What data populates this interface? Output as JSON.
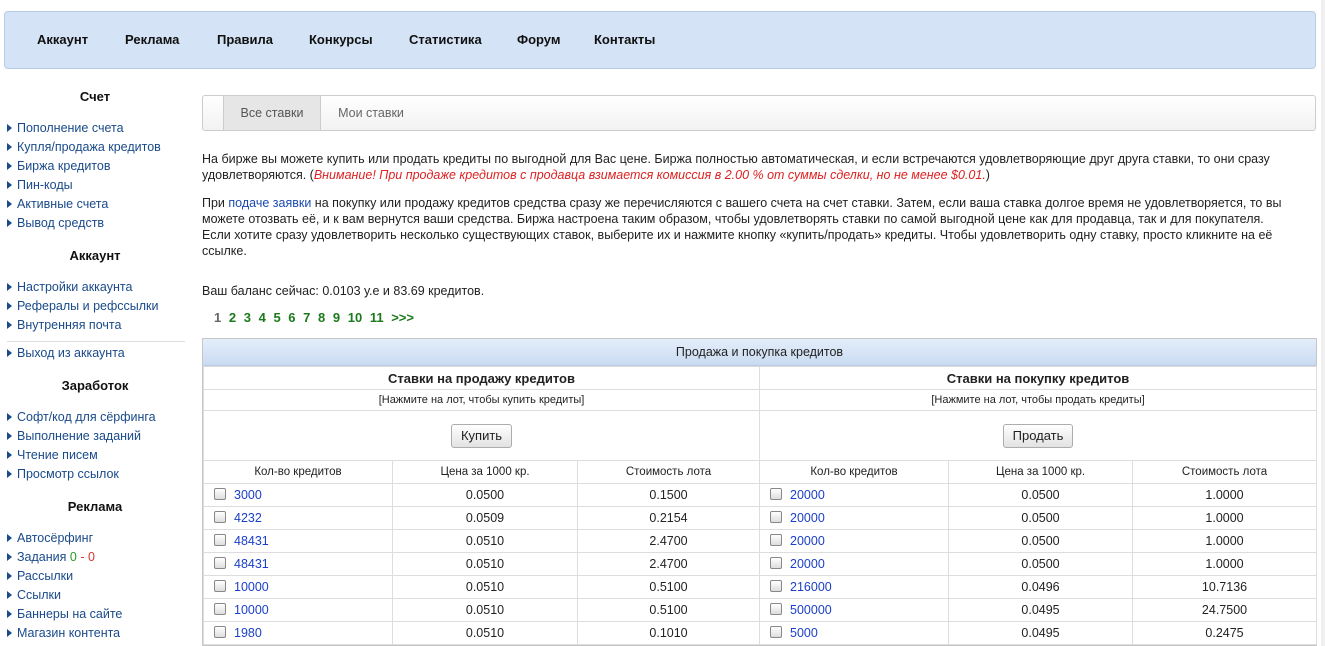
{
  "nav": [
    "Аккаунт",
    "Реклама",
    "Правила",
    "Конкурсы",
    "Статистика",
    "Форум",
    "Контакты"
  ],
  "sidebar": {
    "sections": [
      {
        "title": "Счет",
        "items": [
          {
            "label": "Пополнение счета"
          },
          {
            "label": "Купля/продажа кредитов"
          },
          {
            "label": "Биржа кредитов"
          },
          {
            "label": "Пин-коды"
          },
          {
            "label": "Активные счета"
          },
          {
            "label": "Вывод средств"
          }
        ]
      },
      {
        "title": "Аккаунт",
        "items": [
          {
            "label": "Настройки аккаунта"
          },
          {
            "label": "Рефералы и рефссылки"
          },
          {
            "label": "Внутренняя почта"
          }
        ]
      },
      {
        "title": "",
        "items": [
          {
            "label": "Выход из аккаунта"
          }
        ]
      },
      {
        "title": "Заработок",
        "items": [
          {
            "label": "Софт/код для сёрфинга"
          },
          {
            "label": "Выполнение заданий"
          },
          {
            "label": "Чтение писем"
          },
          {
            "label": "Просмотр ссылок"
          }
        ]
      },
      {
        "title": "Реклама",
        "items": [
          {
            "label": "Автосёрфинг"
          },
          {
            "label": "Задания",
            "badge_a": "0",
            "badge_sep": " - ",
            "badge_b": "0"
          },
          {
            "label": "Рассылки"
          },
          {
            "label": "Ссылки"
          },
          {
            "label": "Баннеры на сайте"
          },
          {
            "label": "Магазин контента"
          }
        ]
      }
    ]
  },
  "tabs": {
    "all": "Все ставки",
    "mine": "Мои ставки"
  },
  "intro": {
    "p1": "На бирже вы можете купить или продать кредиты по выгодной для Вас цене. Биржа полностью автоматическая, и если встречаются удовлетворяющие друг друга ставки, то они сразу удовлетворяются. (",
    "p1_warn": "Внимание! При продаже кредитов с продавца взимается комиссия в 2.00 % от суммы сделки, но не менее $0.01.",
    "p1_end": ")",
    "p2_pre": "При ",
    "p2_link": "подаче заявки",
    "p2_post": " на покупку или продажу кредитов средства сразу же перечисляются с вашего счета на счет ставки. Затем, если ваша ставка долгое время не удовлетворяется, то вы можете отозвать её, и к вам вернутся ваши средства. Биржа настроена таким образом, чтобы удовлетворять ставки по самой выгодной цене как для продавца, так и для покупателя.",
    "p3": "Если хотите сразу удовлетворить несколько существующих ставок, выберите их и нажмите кнопку «купить/продать» кредиты. Чтобы удовлетворить одну ставку, просто кликните на её ссылке.",
    "balance": "Ваш баланс сейчас: 0.0103 у.е и 83.69 кредитов."
  },
  "pagination": {
    "current": "1",
    "links": [
      "2",
      "3",
      "4",
      "5",
      "6",
      "7",
      "8",
      "9",
      "10",
      "11",
      ">>>"
    ]
  },
  "table": {
    "caption": "Продажа и покупка кредитов",
    "sell_title": "Ставки на продажу кредитов",
    "buy_title": "Ставки на покупку кредитов",
    "sell_hint": "[Нажмите на лот, чтобы купить кредиты]",
    "buy_hint": "[Нажмите на лот, чтобы продать кредиты]",
    "buy_button": "Купить",
    "sell_button": "Продать",
    "columns": [
      "Кол-во кредитов",
      "Цена за 1000 кр.",
      "Стоимость лота"
    ],
    "sell_rows": [
      [
        "3000",
        "0.0500",
        "0.1500"
      ],
      [
        "4232",
        "0.0509",
        "0.2154"
      ],
      [
        "48431",
        "0.0510",
        "2.4700"
      ],
      [
        "48431",
        "0.0510",
        "2.4700"
      ],
      [
        "10000",
        "0.0510",
        "0.5100"
      ],
      [
        "10000",
        "0.0510",
        "0.5100"
      ],
      [
        "1980",
        "0.0510",
        "0.1010"
      ]
    ],
    "buy_rows": [
      [
        "20000",
        "0.0500",
        "1.0000"
      ],
      [
        "20000",
        "0.0500",
        "1.0000"
      ],
      [
        "20000",
        "0.0500",
        "1.0000"
      ],
      [
        "20000",
        "0.0500",
        "1.0000"
      ],
      [
        "216000",
        "0.0496",
        "10.7136"
      ],
      [
        "500000",
        "0.0495",
        "24.7500"
      ],
      [
        "5000",
        "0.0495",
        "0.2475"
      ]
    ]
  }
}
